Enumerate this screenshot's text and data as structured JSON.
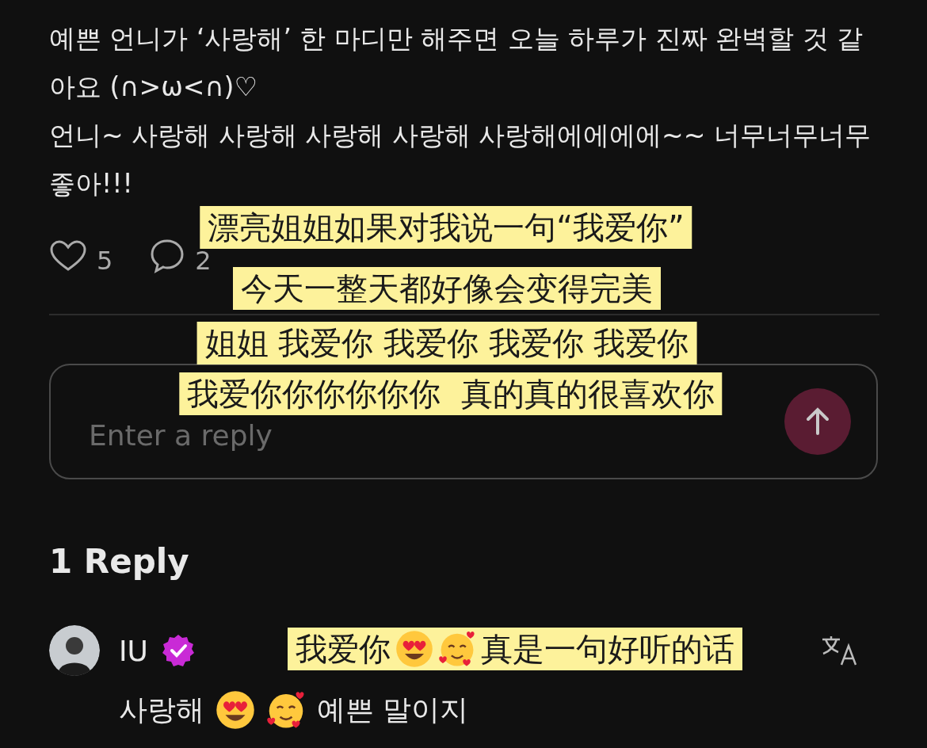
{
  "comment": {
    "paragraphs": [
      "예쁜 언니가 ‘사랑해’ 한 마디만 해주면 오늘 하루가 진짜 완벽할 것 같아요 (∩>ω<∩)♡",
      "언니~ 사랑해 사랑해 사랑해 사랑해 사랑해에에에에~~ 너무너무너무 좋아!!!"
    ],
    "likes": "5",
    "replies": "2"
  },
  "reply_field": {
    "placeholder": "Enter a reply"
  },
  "replies_heading": "1 Reply",
  "reply": {
    "author": "IU",
    "verified": true,
    "parts": [
      {
        "kind": "text",
        "text": "사랑해"
      },
      {
        "kind": "heart-eyes"
      },
      {
        "kind": "smiling-hearts"
      },
      {
        "kind": "text",
        "text": "예쁜 말이지"
      }
    ]
  },
  "captions": [
    {
      "parts": [
        {
          "kind": "text",
          "text": "漂亮姐姐如果对我说一句“我爱你”"
        }
      ]
    },
    {
      "parts": [
        {
          "kind": "text",
          "text": "今天一整天都好像会变得完美"
        }
      ]
    },
    {
      "parts": [
        {
          "kind": "text",
          "text": "姐姐 我爱你 我爱你 我爱你 我爱你"
        }
      ]
    },
    {
      "parts": [
        {
          "kind": "text",
          "text": "我爱你你你你你你  真的真的很喜欢你"
        }
      ]
    },
    {
      "parts": [
        {
          "kind": "text",
          "text": "我爱你"
        },
        {
          "kind": "heart-eyes"
        },
        {
          "kind": "smiling-hearts"
        },
        {
          "kind": "text",
          "text": "真是一句好听的话"
        }
      ]
    }
  ]
}
